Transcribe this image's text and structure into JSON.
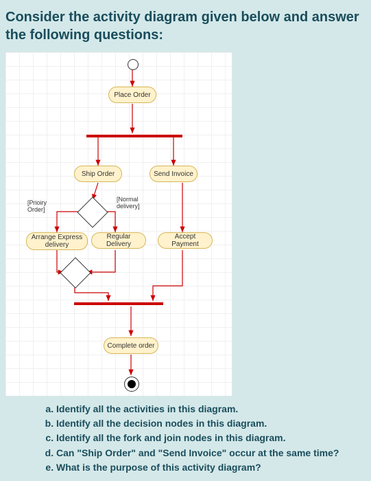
{
  "title": "Consider the activity diagram given below and answer the following questions:",
  "diagram": {
    "activities": {
      "place_order": "Place Order",
      "ship_order": "Ship Order",
      "send_invoice": "Send Invoice",
      "arrange_express": "Arrange Express delivery",
      "regular_delivery": "Regular Delivery",
      "accept_payment": "Accept Payment",
      "complete_order": "Complete order"
    },
    "guards": {
      "priority": "[Prioiry Order]",
      "normal": "[Normal delivery]"
    }
  },
  "questions": {
    "a": "Identify all the activities in this diagram.",
    "b": "Identify all the decision nodes in this diagram.",
    "c": "Identify all the fork and join nodes in this diagram.",
    "d": "Can \"Ship Order\" and \"Send Invoice\" occur at the same time?",
    "e": "What is the purpose of this activity diagram?"
  }
}
